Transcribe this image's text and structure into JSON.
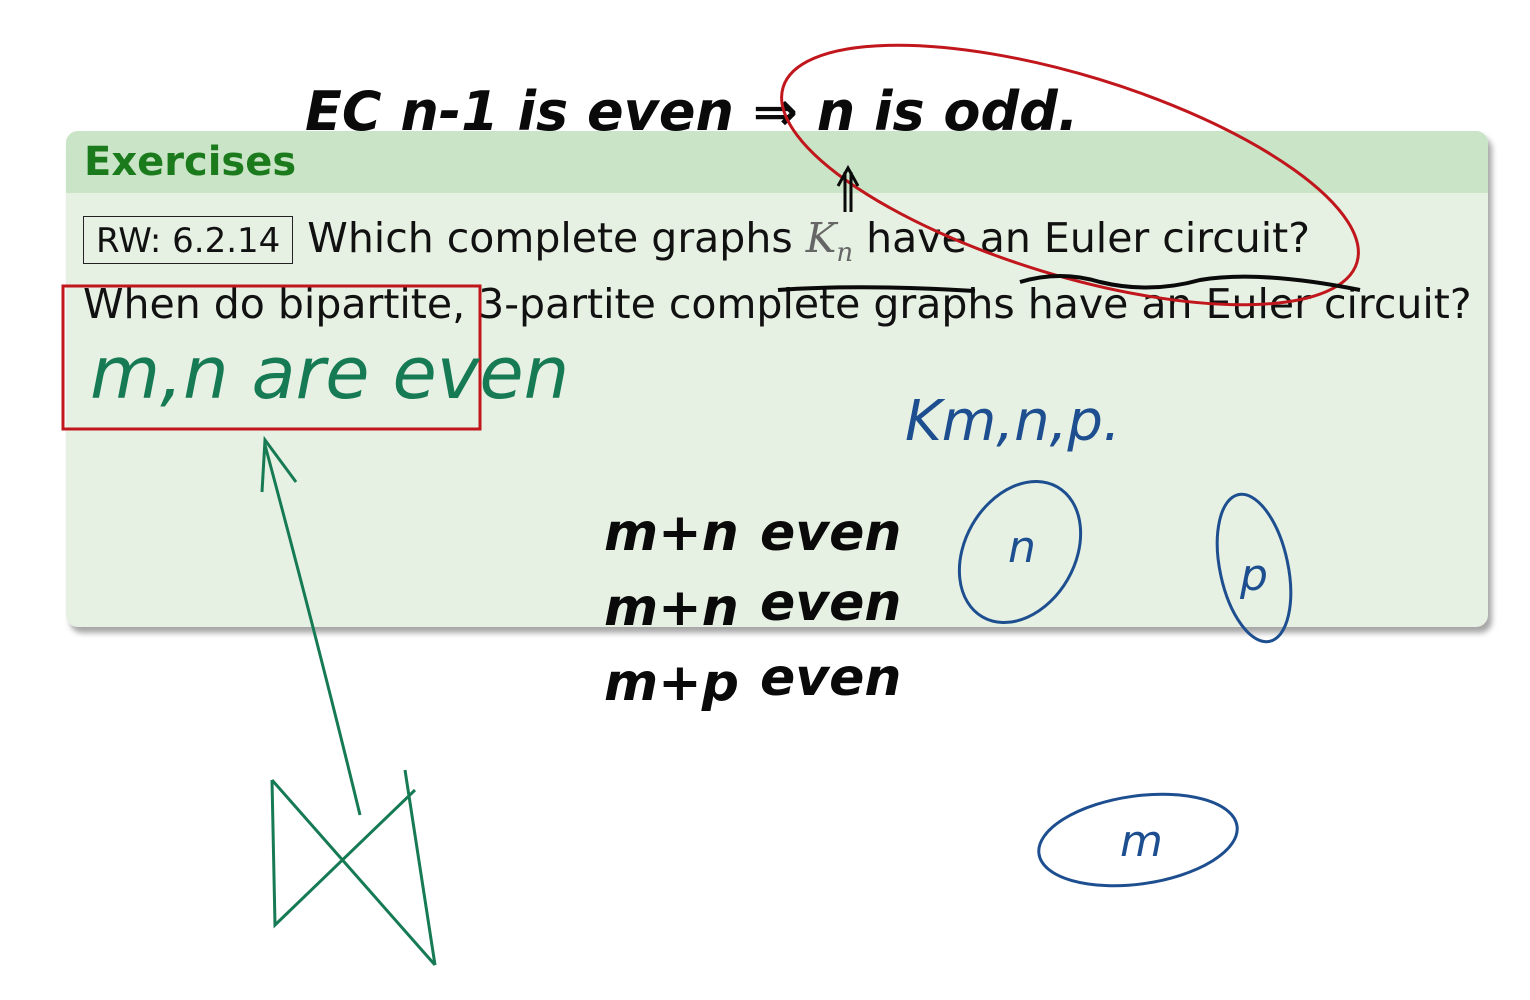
{
  "block": {
    "title": "Exercises",
    "reference": "RW: 6.2.14",
    "question1_pre": "Which complete graphs ",
    "question1_math": "K",
    "question1_sub": "n",
    "question1_post": " have an Euler circuit?",
    "question2": "When do bipartite, 3-partite complete graphs have an Euler circuit?"
  },
  "annotations": {
    "top_note": "EC n-1 is even ⇒ n is odd.",
    "green_note": "m,n are even",
    "blue_label": "Km,n,p.",
    "conditions": [
      {
        "pair": "m+n",
        "word": "even"
      },
      {
        "pair": "m+n",
        "word": "even"
      },
      {
        "pair": "m+p",
        "word": "even"
      }
    ],
    "set_n": "n",
    "set_p": "p",
    "set_m": "m",
    "colors": {
      "green_ink": "#167a54",
      "blue_ink": "#1d4e8f",
      "red_ink": "#c0161c",
      "black_ink": "#0a0a0a"
    }
  }
}
